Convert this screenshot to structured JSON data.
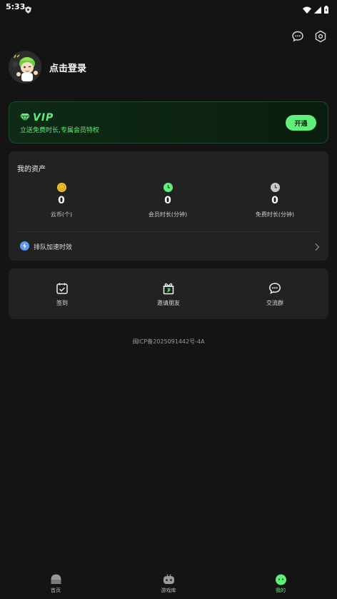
{
  "status_bar": {
    "time": "5:33"
  },
  "profile": {
    "login_label": "点击登录"
  },
  "vip": {
    "title": "VIP",
    "subtitle": "立送免费时长,专属会员特权",
    "button": "开通",
    "accent": "#5ff07a"
  },
  "assets": {
    "title": "我的资产",
    "items": [
      {
        "value": "0",
        "label": "云币(个)",
        "icon": "coin-icon"
      },
      {
        "value": "0",
        "label": "会员时长(分钟)",
        "icon": "member-clock-icon"
      },
      {
        "value": "0",
        "label": "免费时长(分钟)",
        "icon": "free-clock-icon"
      }
    ],
    "queue_label": "排队加速时效"
  },
  "tools": [
    {
      "label": "签到",
      "icon": "checkin-icon"
    },
    {
      "label": "邀请朋友",
      "icon": "gift-icon"
    },
    {
      "label": "交流群",
      "icon": "chat-icon"
    }
  ],
  "icp": "闽ICP备2025091442号-4A",
  "tabs": [
    {
      "label": "首页",
      "icon": "home-icon",
      "active": false
    },
    {
      "label": "游戏库",
      "icon": "gamepad-icon",
      "active": false
    },
    {
      "label": "我的",
      "icon": "profile-icon",
      "active": true
    }
  ]
}
